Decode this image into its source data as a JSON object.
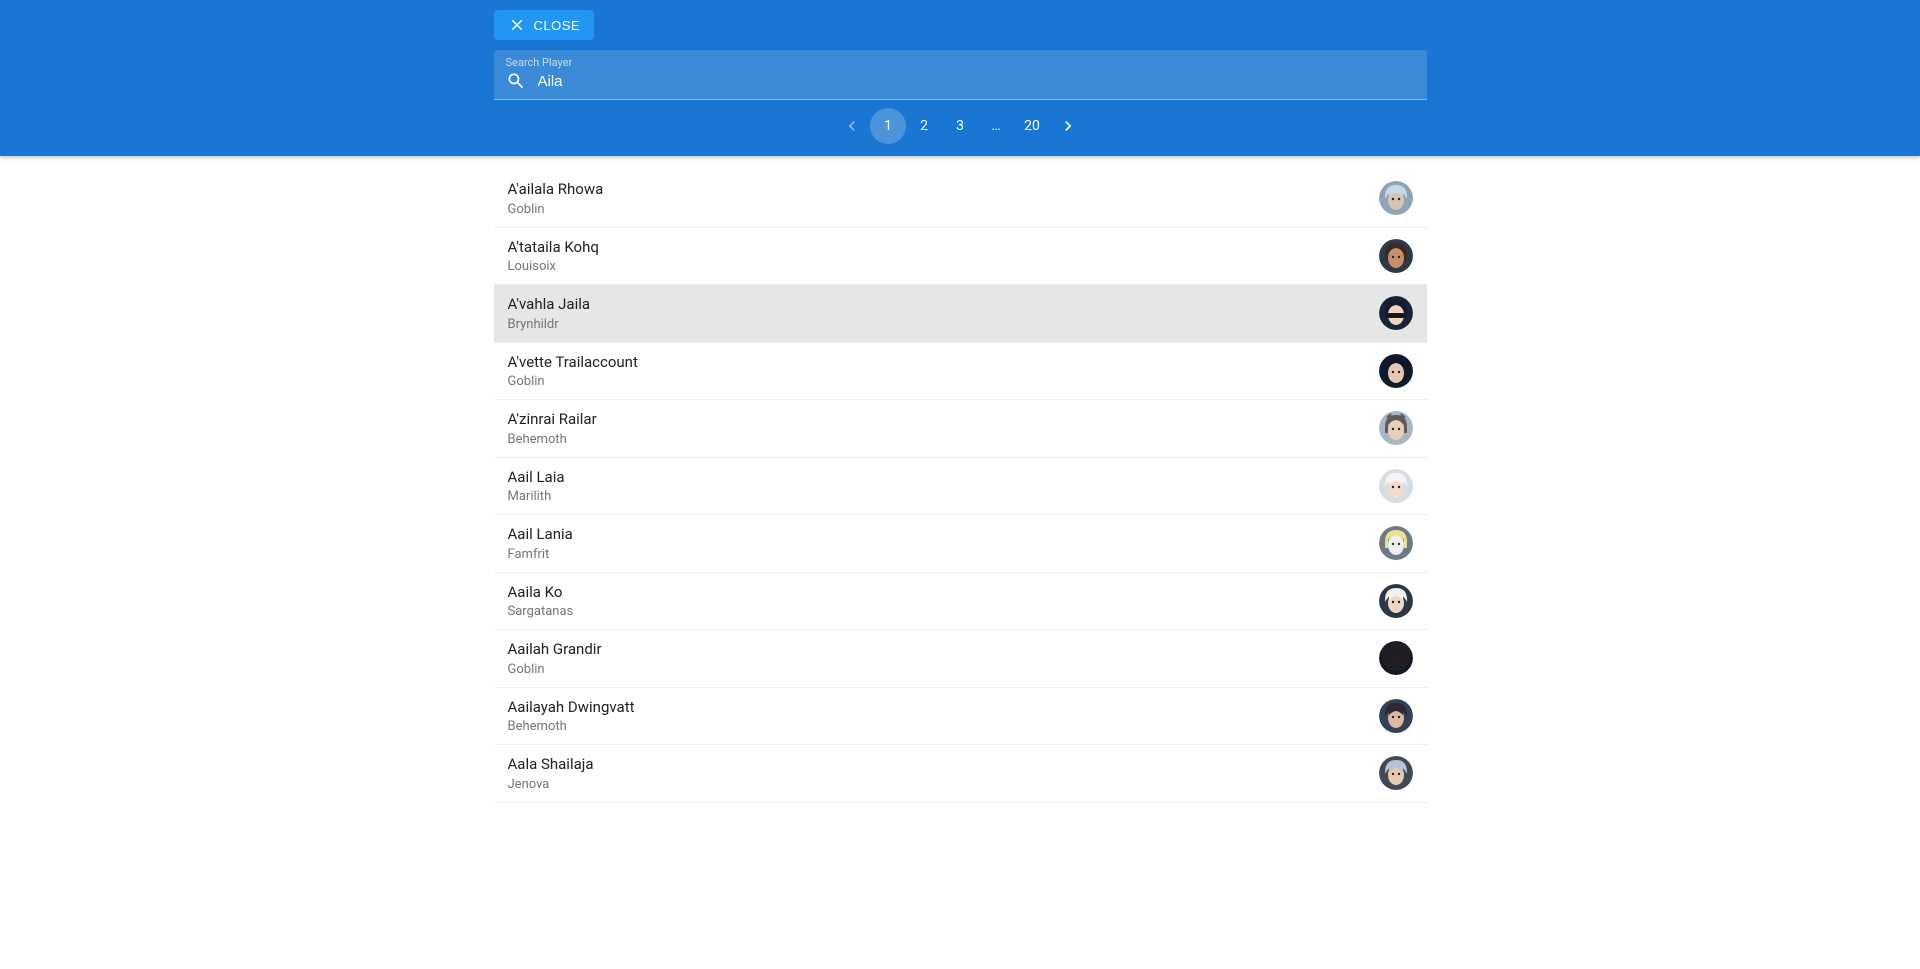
{
  "header": {
    "close_label": "CLOSE",
    "search_label": "Search Player",
    "search_value": "Aila"
  },
  "pagination": {
    "pages": [
      "1",
      "2",
      "3",
      "…",
      "20"
    ],
    "active_index": 0
  },
  "results": [
    {
      "name": "A'ailala Rhowa",
      "server": "Goblin",
      "avatar": {
        "bg": "#8fa3b8",
        "skin": "#d8c2b2",
        "hair": "#c9d6e6",
        "bangs": true
      }
    },
    {
      "name": "A'tataila Kohq",
      "server": "Louisoix",
      "avatar": {
        "bg": "#2e3a4a",
        "skin": "#c68e6b",
        "hair": "#3b2b22",
        "bangs": false
      }
    },
    {
      "name": "A'vahla Jaila",
      "server": "Brynhildr",
      "avatar": {
        "bg": "#16243a",
        "skin": "#f0d6c2",
        "hair": "#1a1a2e",
        "mask": true
      },
      "hovered": true
    },
    {
      "name": "A'vette Trailaccount",
      "server": "Goblin",
      "avatar": {
        "bg": "#0c1a2b",
        "skin": "#e5c7b3",
        "hair": "#141825",
        "bangs": false
      }
    },
    {
      "name": "A'zinrai Railar",
      "server": "Behemoth",
      "avatar": {
        "bg": "#a9b6c4",
        "skin": "#e8cdb9",
        "hair": "#5f5a58",
        "ears": true
      }
    },
    {
      "name": "Aail Laia",
      "server": "Marilith",
      "avatar": {
        "bg": "#d6dde4",
        "skin": "#f2dccc",
        "hair": "#f4f4f7",
        "bangs": true
      }
    },
    {
      "name": "Aail Lania",
      "server": "Famfrit",
      "avatar": {
        "bg": "#6e7a86",
        "skin": "#eef0f4",
        "hair": "#e8e28a",
        "paleface": true
      }
    },
    {
      "name": "Aaila Ko",
      "server": "Sargatanas",
      "avatar": {
        "bg": "#2b3745",
        "skin": "#efd7c6",
        "hair": "#f2f2ee",
        "bangs": true
      }
    },
    {
      "name": "Aailah Grandir",
      "server": "Goblin",
      "avatar": {
        "bg": "#101828",
        "skin": "#e0bfa6",
        "hair": "#201e22",
        "bighair": true
      }
    },
    {
      "name": "Aailayah Dwingvatt",
      "server": "Behemoth",
      "avatar": {
        "bg": "#324156",
        "skin": "#d9b9a0",
        "hair": "#2b2733",
        "bangs": true
      }
    },
    {
      "name": "Aala Shailaja",
      "server": "Jenova",
      "avatar": {
        "bg": "#3f4955",
        "skin": "#e5c9b4",
        "hair": "#b6c3d2",
        "bangs": true
      }
    }
  ]
}
